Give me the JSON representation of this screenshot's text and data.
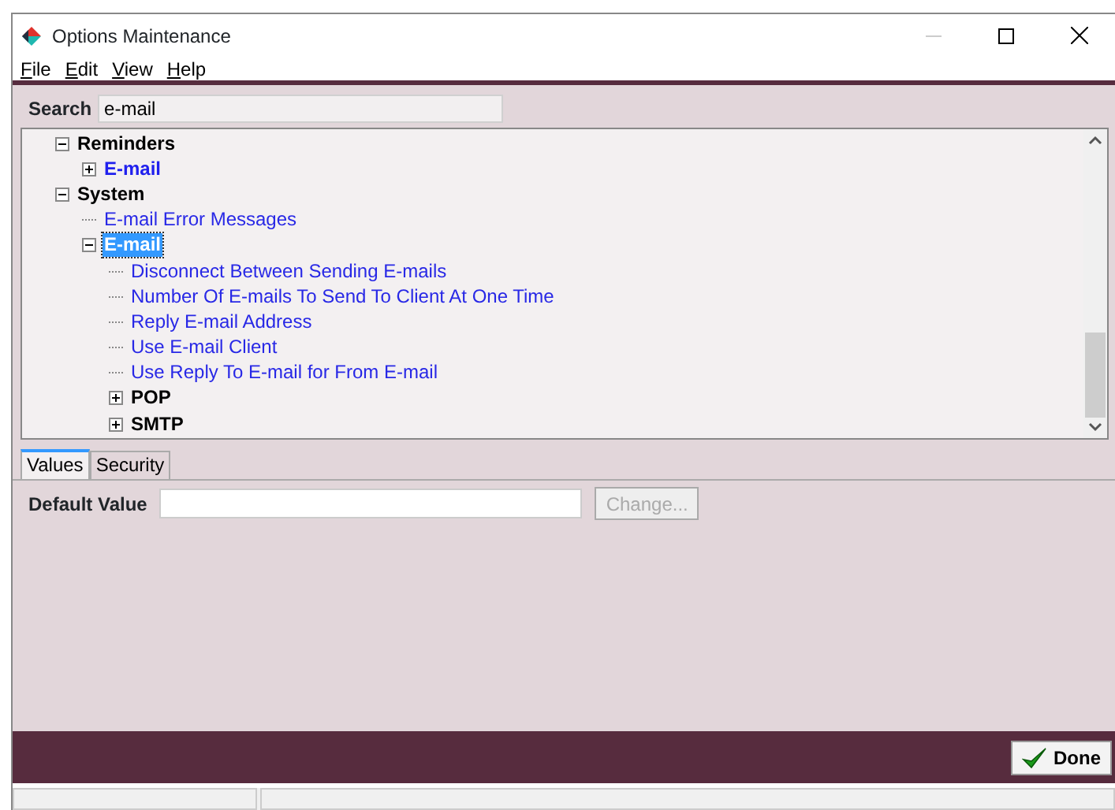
{
  "window": {
    "title": "Options Maintenance"
  },
  "menu": [
    {
      "label": "File",
      "underline_first": true
    },
    {
      "label": "Edit",
      "underline_first": true
    },
    {
      "label": "View",
      "underline_first": true
    },
    {
      "label": "Help",
      "underline_first": true
    }
  ],
  "search": {
    "label": "Search",
    "value": "e-mail"
  },
  "tree": [
    {
      "label": "Reminders",
      "kind": "group",
      "expanded": true,
      "selected": false,
      "children": [
        {
          "label": "E-mail",
          "kind": "match",
          "expanded": false,
          "selected": false
        }
      ]
    },
    {
      "label": "System",
      "kind": "group",
      "expanded": true,
      "selected": false,
      "children": [
        {
          "label": "E-mail Error Messages",
          "kind": "option",
          "selected": false
        },
        {
          "label": "E-mail",
          "kind": "match",
          "expanded": true,
          "selected": true,
          "children": [
            {
              "label": "Disconnect Between Sending E-mails",
              "kind": "option",
              "selected": false
            },
            {
              "label": "Number Of E-mails To Send To Client At One Time",
              "kind": "option",
              "selected": false
            },
            {
              "label": "Reply E-mail Address",
              "kind": "option",
              "selected": false
            },
            {
              "label": "Use E-mail Client",
              "kind": "option",
              "selected": false
            },
            {
              "label": "Use Reply To E-mail for From E-mail",
              "kind": "option",
              "selected": false
            },
            {
              "label": "POP",
              "kind": "group",
              "expanded": false,
              "selected": false
            },
            {
              "label": "SMTP",
              "kind": "group",
              "expanded": false,
              "selected": false
            }
          ]
        }
      ]
    }
  ],
  "tabs": [
    {
      "label": "Values",
      "selected": true
    },
    {
      "label": "Security",
      "selected": false
    }
  ],
  "default_value": {
    "label": "Default Value",
    "button": {
      "label": "Change...",
      "disabled": true
    }
  },
  "done_button": {
    "label": "Done"
  }
}
